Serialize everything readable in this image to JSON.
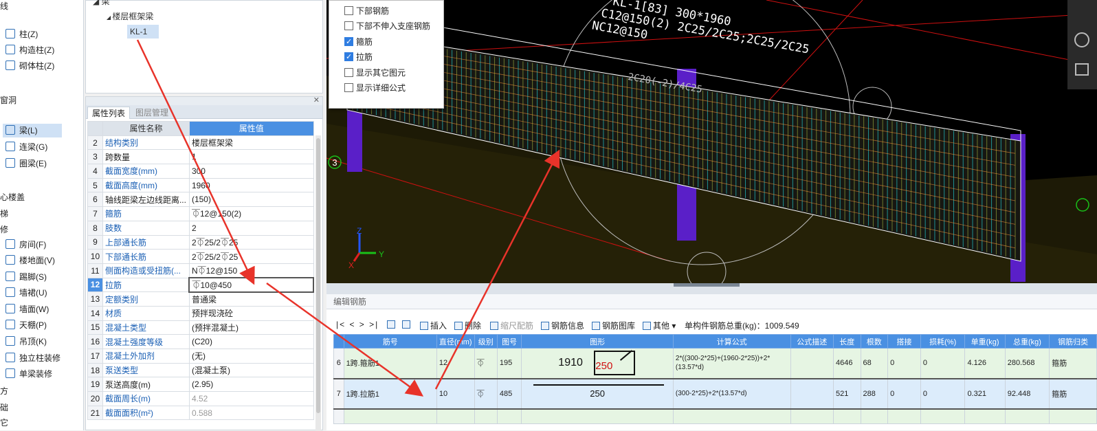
{
  "left_nav": {
    "top_fragment": "线",
    "items": [
      {
        "label": "柱(Z)",
        "icon": "column-icon"
      },
      {
        "label": "构造柱(Z)",
        "icon": "constructional-column-icon"
      },
      {
        "label": "砌体柱(Z)",
        "icon": "masonry-column-icon"
      },
      {
        "label": "梁(L)",
        "icon": "beam-icon",
        "active": true
      },
      {
        "label": "连梁(G)",
        "icon": "coupling-beam-icon"
      },
      {
        "label": "圈梁(E)",
        "icon": "ring-beam-icon"
      },
      {
        "label": "房间(F)",
        "icon": "room-icon"
      },
      {
        "label": "楼地面(V)",
        "icon": "floor-icon"
      },
      {
        "label": "踢脚(S)",
        "icon": "skirting-icon"
      },
      {
        "label": "墙裙(U)",
        "icon": "dado-icon"
      },
      {
        "label": "墙面(W)",
        "icon": "wall-face-icon"
      },
      {
        "label": "天棚(P)",
        "icon": "ceiling-icon"
      },
      {
        "label": "吊顶(K)",
        "icon": "suspended-ceiling-icon"
      },
      {
        "label": "独立柱装修",
        "icon": "column-decoration-icon"
      },
      {
        "label": "单梁装修",
        "icon": "beam-decoration-icon"
      }
    ],
    "sections": [
      "窗洞",
      "心楼盖",
      "梯",
      "修",
      "方",
      "础",
      "它"
    ]
  },
  "tree": {
    "root_fragment": "梁",
    "group": "楼层框架梁",
    "selected": "KL-1"
  },
  "property_panel": {
    "tabs": [
      "属性列表",
      "图层管理"
    ],
    "columns": [
      "属性名称",
      "属性值"
    ],
    "rows": [
      {
        "n": "2",
        "name": "结构类别",
        "value": "楼层框架梁"
      },
      {
        "n": "3",
        "name": "跨数量",
        "value": "1",
        "black": true
      },
      {
        "n": "4",
        "name": "截面宽度(mm)",
        "value": "300"
      },
      {
        "n": "5",
        "name": "截面高度(mm)",
        "value": "1960"
      },
      {
        "n": "6",
        "name": "轴线距梁左边线距离...",
        "value": "(150)",
        "black": true
      },
      {
        "n": "7",
        "name": "箍筋",
        "value": "⏁12@150(2)"
      },
      {
        "n": "8",
        "name": "肢数",
        "value": "2"
      },
      {
        "n": "9",
        "name": "上部通长筋",
        "value": "2⏁25/2⏁25"
      },
      {
        "n": "10",
        "name": "下部通长筋",
        "value": "2⏁25/2⏁25"
      },
      {
        "n": "11",
        "name": "侧面构造或受扭筋(...",
        "value": "N⏁12@150"
      },
      {
        "n": "12",
        "name": "拉筋",
        "value": "⏁10@450",
        "selected": true
      },
      {
        "n": "13",
        "name": "定额类别",
        "value": "普通梁"
      },
      {
        "n": "14",
        "name": "材质",
        "value": "预拌现浇砼"
      },
      {
        "n": "15",
        "name": "混凝土类型",
        "value": "(预拌混凝土)"
      },
      {
        "n": "16",
        "name": "混凝土强度等级",
        "value": "(C20)"
      },
      {
        "n": "17",
        "name": "混凝土外加剂",
        "value": "(无)"
      },
      {
        "n": "18",
        "name": "泵送类型",
        "value": "(混凝土泵)"
      },
      {
        "n": "19",
        "name": "泵送高度(m)",
        "value": "(2.95)",
        "black": true
      },
      {
        "n": "20",
        "name": "截面周长(m)",
        "value": "4.52",
        "gray": true
      },
      {
        "n": "21",
        "name": "截面面积(m²)",
        "value": "0.588",
        "gray": true
      }
    ]
  },
  "display_popup": {
    "items": [
      {
        "label": "下部钢筋",
        "checked": false
      },
      {
        "label": "下部不伸入支座钢筋",
        "checked": false
      },
      {
        "label": "箍筋",
        "checked": true
      },
      {
        "label": "拉筋",
        "checked": true
      },
      {
        "label": "显示其它图元",
        "checked": false
      },
      {
        "label": "显示详细公式",
        "checked": false
      }
    ]
  },
  "viewport": {
    "annotation_lines": [
      "KL-1[83] 300*1960",
      "C12@150(2) 2C25/2C25;2C25/2C25",
      "NC12@150"
    ],
    "bottom_label": "2C20(-2)/4C25",
    "axis_label": "3",
    "axis_x": "X",
    "axis_y": "Y",
    "axis_z": "Z"
  },
  "editor": {
    "title": "编辑钢筋",
    "nav": "|<  <  >  >|",
    "toolbar": {
      "insert": "插入",
      "delete": "删除",
      "scale": "缩尺配筋",
      "info": "钢筋信息",
      "library": "钢筋图库",
      "other": "其他",
      "total": "单构件钢筋总重(kg)：1009.549"
    },
    "columns": [
      "筋号",
      "直径(mm)",
      "级别",
      "图号",
      "图形",
      "计算公式",
      "公式描述",
      "长度",
      "根数",
      "搭接",
      "损耗(%)",
      "单重(kg)",
      "总重(kg)",
      "钢筋归类"
    ],
    "rows": [
      {
        "n": "6",
        "name": "1跨.箍筋1",
        "dia": "12",
        "grade": "⏁",
        "fig": "195",
        "shape_a": "1910",
        "shape_b": "250",
        "formula": "2*((300-2*25)+(1960-2*25))+2*(13.57*d)",
        "formula_desc": "",
        "length": "4646",
        "count": "68",
        "lap": "0",
        "loss": "0",
        "unit": "4.126",
        "total": "280.568",
        "category": "箍筋"
      },
      {
        "n": "7",
        "name": "1跨.拉筋1",
        "dia": "10",
        "grade": "⏁",
        "fig": "485",
        "shape_a": "250",
        "shape_b": "",
        "formula": "(300-2*25)+2*(13.57*d)",
        "formula_desc": "",
        "length": "521",
        "count": "288",
        "lap": "0",
        "loss": "0",
        "unit": "0.321",
        "total": "92.448",
        "category": "箍筋"
      }
    ]
  },
  "colors": {
    "accent": "#4a90e2",
    "arrow": "#e8332a",
    "beam_wire": "#ffffff",
    "rebar_tie": "#22c4c8",
    "rebar_stirrup": "#ff9a3a",
    "column": "#5a1fc8"
  }
}
